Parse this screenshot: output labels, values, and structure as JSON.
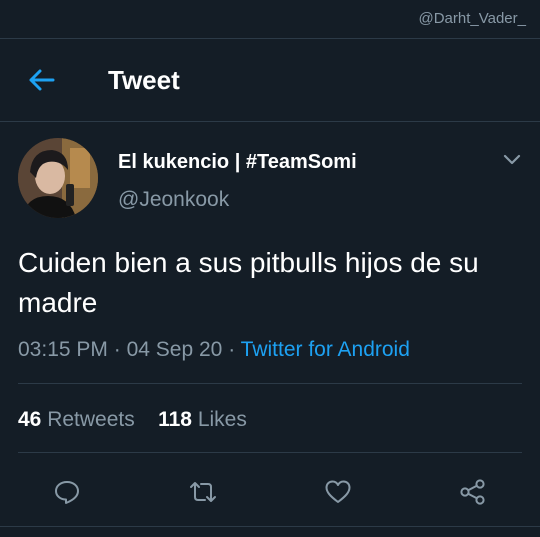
{
  "watermark": "@Darht_Vader_",
  "header": {
    "title": "Tweet",
    "back_icon": "arrow-left-icon"
  },
  "tweet": {
    "author_name": "El kukencio | #TeamSomi",
    "author_handle": "@Jeonkook",
    "text": "Cuiden bien a sus pitbulls hijos de su madre",
    "time": "03:15 PM",
    "date": "04 Sep 20",
    "separator": "·",
    "source": "Twitter for Android",
    "retweets_count": "46",
    "retweets_label": "Retweets",
    "likes_count": "118",
    "likes_label": "Likes"
  },
  "actions": [
    {
      "name": "reply",
      "icon": "comment-icon"
    },
    {
      "name": "retweet",
      "icon": "retweet-icon"
    },
    {
      "name": "like",
      "icon": "heart-icon"
    },
    {
      "name": "share",
      "icon": "share-icon"
    }
  ],
  "colors": {
    "background": "#141d26",
    "accent": "#1da1f2",
    "secondary_text": "#8899a6",
    "divider": "#2c3a47"
  }
}
